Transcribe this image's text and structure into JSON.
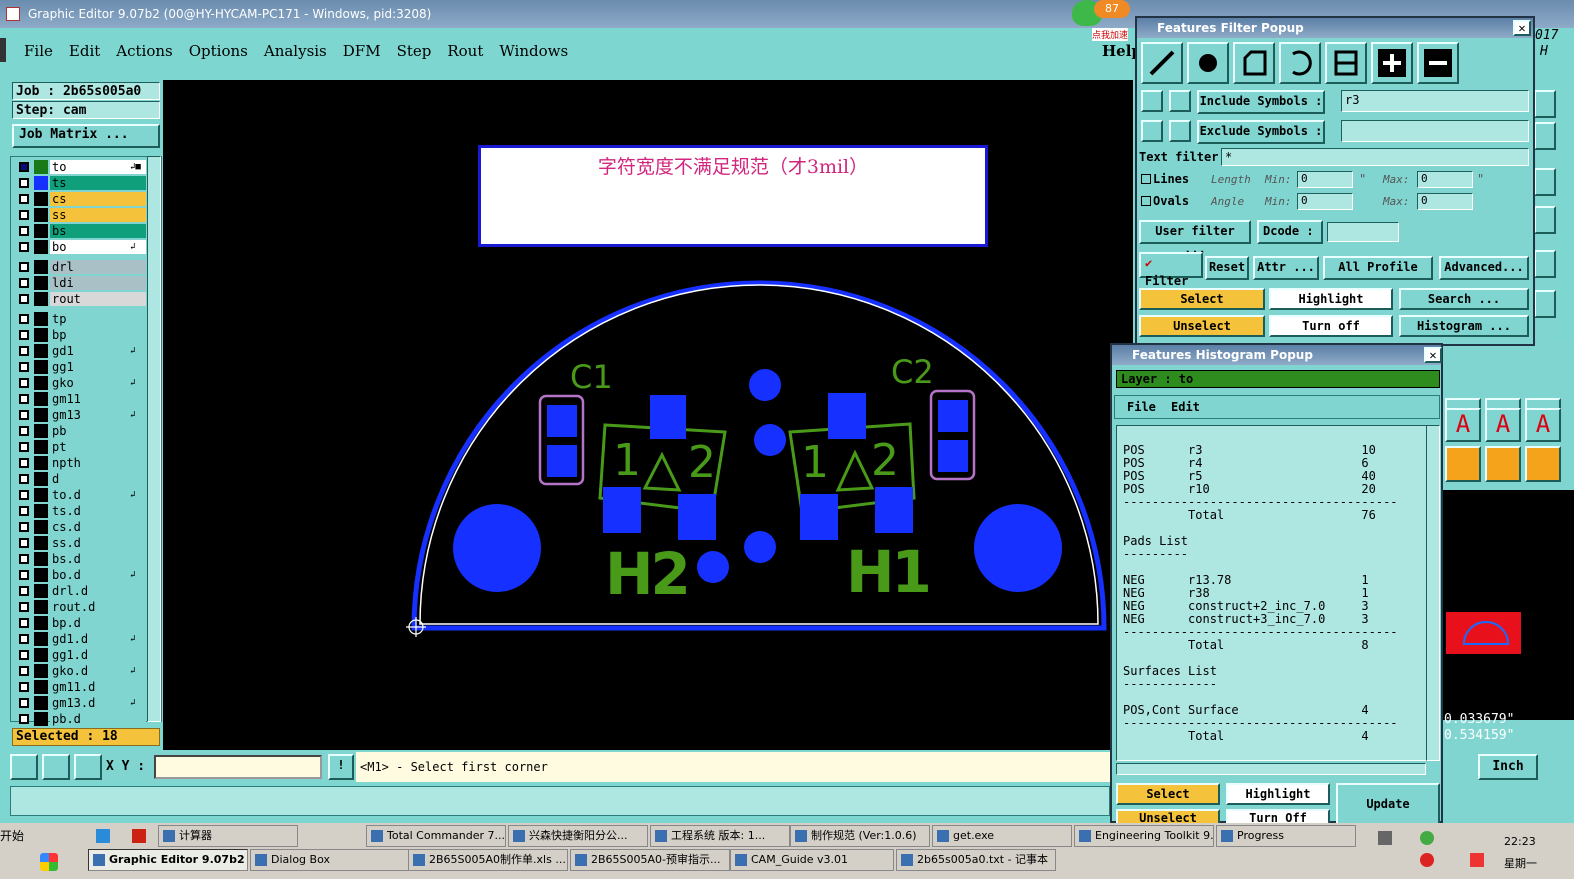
{
  "window": {
    "title": "Graphic Editor 9.07b2 (00@HY-HYCAM-PC171 - Windows, pid:3208)"
  },
  "menu": [
    "File",
    "Edit",
    "Actions",
    "Options",
    "Analysis",
    "DFM",
    "Step",
    "Rout",
    "Windows"
  ],
  "help_label": "Help",
  "badge": {
    "count": "87",
    "caption": "点我加速"
  },
  "job": {
    "job_label": "Job : 2b65s005a0",
    "step_label": "Step: cam",
    "matrix_button": "Job Matrix ..."
  },
  "layers": [
    {
      "name": "to",
      "color": "#ffffff",
      "active": true,
      "mark": "↲■"
    },
    {
      "name": "ts",
      "color": "#0fa07b"
    },
    {
      "name": "cs",
      "color": "#f5c33b"
    },
    {
      "name": "ss",
      "color": "#f5c33b"
    },
    {
      "name": "bs",
      "color": "#0fa07b"
    },
    {
      "name": "bo",
      "color": "#ffffff",
      "mark": "↲"
    },
    {
      "name": "drl",
      "color": "#a9c1c6",
      "gap": true
    },
    {
      "name": "ldi",
      "color": "#a9c1c6"
    },
    {
      "name": "rout",
      "color": "#d8d8d8"
    },
    {
      "name": "tp",
      "color": "#80d5d0",
      "gap": true
    },
    {
      "name": "bp",
      "color": "#80d5d0"
    },
    {
      "name": "gd1",
      "color": "#80d5d0",
      "mark": "↲"
    },
    {
      "name": "gg1",
      "color": "#80d5d0"
    },
    {
      "name": "gko",
      "color": "#80d5d0",
      "mark": "↲"
    },
    {
      "name": "gm11",
      "color": "#80d5d0"
    },
    {
      "name": "gm13",
      "color": "#80d5d0",
      "mark": "↲"
    },
    {
      "name": "pb",
      "color": "#80d5d0"
    },
    {
      "name": "pt",
      "color": "#80d5d0"
    },
    {
      "name": "npth",
      "color": "#80d5d0"
    },
    {
      "name": "d",
      "color": "#80d5d0"
    },
    {
      "name": "to.d",
      "color": "#80d5d0",
      "mark": "↲"
    },
    {
      "name": "ts.d",
      "color": "#80d5d0"
    },
    {
      "name": "cs.d",
      "color": "#80d5d0"
    },
    {
      "name": "ss.d",
      "color": "#80d5d0"
    },
    {
      "name": "bs.d",
      "color": "#80d5d0"
    },
    {
      "name": "bo.d",
      "color": "#80d5d0",
      "mark": "↲"
    },
    {
      "name": "drl.d",
      "color": "#80d5d0"
    },
    {
      "name": "rout.d",
      "color": "#80d5d0"
    },
    {
      "name": "bp.d",
      "color": "#80d5d0"
    },
    {
      "name": "gd1.d",
      "color": "#80d5d0",
      "mark": "↲"
    },
    {
      "name": "gg1.d",
      "color": "#80d5d0"
    },
    {
      "name": "gko.d",
      "color": "#80d5d0",
      "mark": "↲"
    },
    {
      "name": "gm11.d",
      "color": "#80d5d0"
    },
    {
      "name": "gm13.d",
      "color": "#80d5d0",
      "mark": "↲"
    },
    {
      "name": "pb.d",
      "color": "#80d5d0"
    }
  ],
  "selected_label": "Selected : 18",
  "canvas": {
    "note": "字符宽度不满足规范（才3mil）",
    "labels": {
      "c1": "C1",
      "c2": "C2",
      "h1": "H1",
      "h2": "H2",
      "n1": "1",
      "n2": "2"
    }
  },
  "status": {
    "xy_label": "X Y :",
    "prompt": "<M1> - Select first corner"
  },
  "coords": {
    "x": "0.033679\"",
    "y": "0.534159\"",
    "units": "Inch"
  },
  "filter_popup": {
    "title": "Features Filter Popup",
    "include_label": "Include Symbols :",
    "include_value": "r3",
    "exclude_label": "Exclude Symbols :",
    "exclude_value": "",
    "text_filter_label": "Text filter",
    "text_filter_value": "*",
    "lines_label": "Lines",
    "ovals_label": "Ovals",
    "length_label": "Length",
    "angle_label": "Angle",
    "min_label": "Min:",
    "max_label": "Max:",
    "length_min": "0",
    "length_max": "0",
    "angle_min": "0",
    "angle_max": "0",
    "unit_mark": "\"",
    "user_filter": "User filter ...",
    "dcode": "Dcode :",
    "filter_toggle": "Filter",
    "reset": "Reset",
    "attr": "Attr ...",
    "profile": "All Profile",
    "advanced": "Advanced...",
    "select": "Select",
    "highlight": "Highlight",
    "search": "Search ...",
    "unselect": "Unselect",
    "turn_off": "Turn off",
    "histogram": "Histogram ..."
  },
  "hist_popup": {
    "title": "Features Histogram Popup",
    "layer": "Layer :  to",
    "menu_file": "File",
    "menu_edit": "Edit",
    "lines": [
      "POS      r3                      10",
      "POS      r4                      6",
      "POS      r5                      40",
      "POS      r10                     20",
      "--------------------------------------",
      "         Total                   76",
      "",
      "Pads List",
      "---------",
      "",
      "NEG      r13.78                  1",
      "NEG      r38                     1",
      "NEG      construct+2_inc_7.0     3",
      "NEG      construct+3_inc_7.0     3",
      "--------------------------------------",
      "         Total                   8",
      "",
      "Surfaces List",
      "-------------",
      "",
      "POS,Cont Surface                 4",
      "--------------------------------------",
      "         Total                   4"
    ],
    "select": "Select",
    "highlight": "Highlight",
    "update": "Update",
    "unselect": "Unselect",
    "turn_off": "Turn Off"
  },
  "taskbar": {
    "start": "开始",
    "top_items": [
      "计算器",
      "Total Commander 7....",
      "兴森快捷衡阳分公...",
      "工程系统  版本: 1...",
      "制作规范 (Ver:1.0.6)",
      "get.exe",
      "Engineering Toolkit 9....",
      "Progress"
    ],
    "bottom_items": [
      "Graphic Editor 9.07b2 ...",
      "Dialog Box",
      "2B65S005A0制作单.xls ...",
      "2B65S005A0-预审指示...",
      "CAM_Guide v3.01",
      "2b65s005a0.txt - 记事本"
    ],
    "clock": "22:23",
    "day": "星期一"
  },
  "right_edge": {
    "year_frag": "017",
    "h_frag": "H"
  }
}
